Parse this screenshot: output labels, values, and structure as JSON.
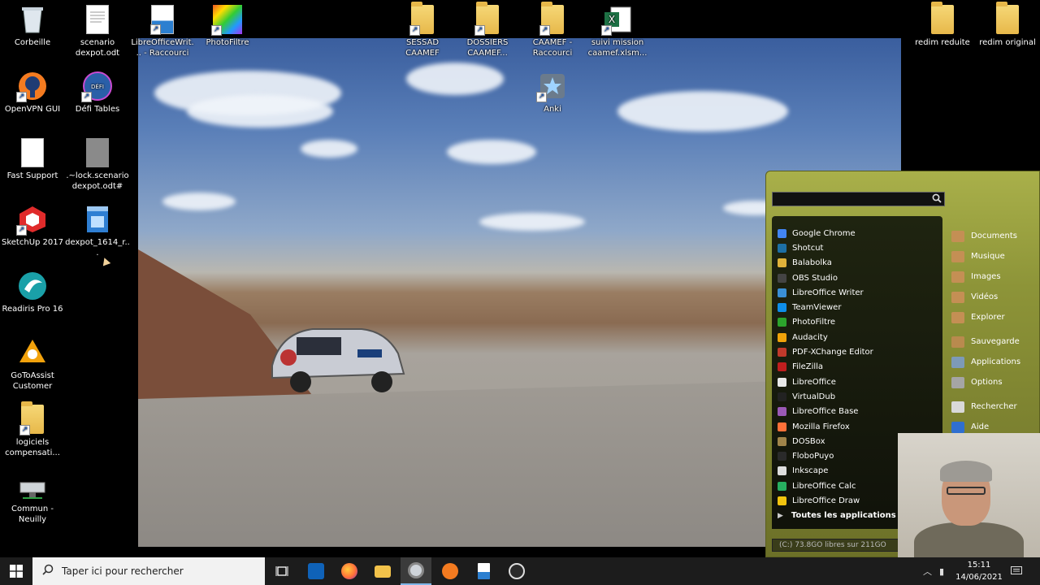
{
  "desktop_icons": [
    {
      "label": "Corbeille",
      "icon": "recycle-bin-icon"
    },
    {
      "label": "scenario dexpot.odt",
      "icon": "document-icon"
    },
    {
      "label": "LibreOfficeWrit... - Raccourci",
      "icon": "libreoffice-writer-icon"
    },
    {
      "label": "PhotoFiltre",
      "icon": "photofiltre-icon"
    },
    {
      "label": "SESSAD CAAMEF",
      "icon": "folder-icon"
    },
    {
      "label": "DOSSIERS CAAMEF...",
      "icon": "folder-icon"
    },
    {
      "label": "CAAMEF - Raccourci",
      "icon": "folder-icon"
    },
    {
      "label": "suivi mission caamef.xlsm...",
      "icon": "excel-icon"
    },
    {
      "label": "redim reduite",
      "icon": "folder-icon"
    },
    {
      "label": "redim original",
      "icon": "folder-icon"
    },
    {
      "label": "OpenVPN GUI",
      "icon": "openvpn-icon"
    },
    {
      "label": "Défi Tables",
      "icon": "defi-tables-icon"
    },
    {
      "label": "Anki",
      "icon": "anki-icon"
    },
    {
      "label": "Fast Support",
      "icon": "blank-file-icon"
    },
    {
      "label": ".~lock.scenario dexpot.odt#",
      "icon": "lock-file-icon"
    },
    {
      "label": "SketchUp 2017",
      "icon": "sketchup-icon"
    },
    {
      "label": "dexpot_1614_r...",
      "icon": "installer-icon"
    },
    {
      "label": "Readiris Pro 16",
      "icon": "readiris-icon"
    },
    {
      "label": "GoToAssist Customer",
      "icon": "gotoassist-icon"
    },
    {
      "label": "logiciels compensati...",
      "icon": "folder-icon"
    },
    {
      "label": "Commun - Neuilly",
      "icon": "network-drive-icon"
    }
  ],
  "launcher": {
    "search_placeholder": "",
    "apps": [
      {
        "label": "Google Chrome",
        "color": "#4285f4"
      },
      {
        "label": "Shotcut",
        "color": "#1d6fa5"
      },
      {
        "label": "Balabolka",
        "color": "#e0b23a"
      },
      {
        "label": "OBS Studio",
        "color": "#444444"
      },
      {
        "label": "LibreOffice Writer",
        "color": "#3a8fd6"
      },
      {
        "label": "TeamViewer",
        "color": "#0e8ee9"
      },
      {
        "label": "PhotoFiltre",
        "color": "#2ca32c"
      },
      {
        "label": "Audacity",
        "color": "#f0a30a"
      },
      {
        "label": "PDF-XChange Editor",
        "color": "#c0392b"
      },
      {
        "label": "FileZilla",
        "color": "#bf1e1e"
      },
      {
        "label": "LibreOffice",
        "color": "#e8e8e8"
      },
      {
        "label": "VirtualDub",
        "color": "#222222"
      },
      {
        "label": "LibreOffice Base",
        "color": "#9b59b6"
      },
      {
        "label": "Mozilla Firefox",
        "color": "#ff7139"
      },
      {
        "label": "DOSBox",
        "color": "#a0844a"
      },
      {
        "label": "FloboPuyo",
        "color": "#2a2a2a"
      },
      {
        "label": "Inkscape",
        "color": "#dddddd"
      },
      {
        "label": "LibreOffice Calc",
        "color": "#27ae60"
      },
      {
        "label": "LibreOffice Draw",
        "color": "#f1c40f"
      }
    ],
    "all_apps_label": "Toutes les applications portables",
    "places": [
      {
        "label": "Documents"
      },
      {
        "label": "Musique"
      },
      {
        "label": "Images"
      },
      {
        "label": "Vidéos"
      },
      {
        "label": "Explorer"
      },
      {
        "label": "Sauvegarde"
      },
      {
        "label": "Applications"
      },
      {
        "label": "Options"
      },
      {
        "label": "Rechercher"
      },
      {
        "label": "Aide"
      }
    ],
    "disk_info": "(C:) 73.8GO libres sur 211GO"
  },
  "taskbar": {
    "search_placeholder": "Taper ici pour rechercher",
    "time": "15:11",
    "date": "14/06/2021"
  }
}
